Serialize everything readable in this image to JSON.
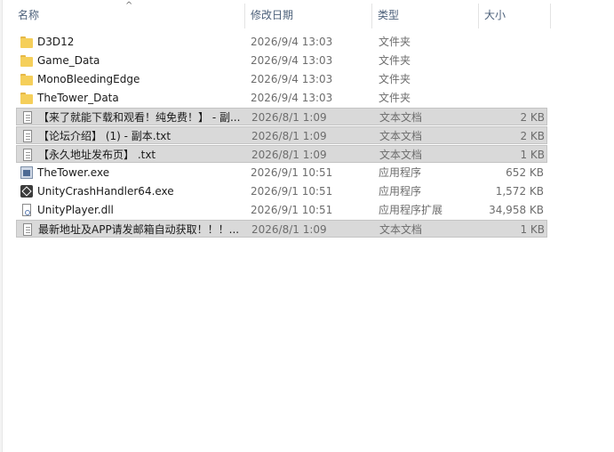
{
  "columns": {
    "name": "名称",
    "date": "修改日期",
    "type": "类型",
    "size": "大小",
    "sort_indicator": "^"
  },
  "files": [
    {
      "name": "D3D12",
      "date": "2026/9/4 13:03",
      "type": "文件夹",
      "size": "",
      "icon": "folder-icon",
      "selected": false
    },
    {
      "name": "Game_Data",
      "date": "2026/9/4 13:03",
      "type": "文件夹",
      "size": "",
      "icon": "folder-icon",
      "selected": false
    },
    {
      "name": "MonoBleedingEdge",
      "date": "2026/9/4 13:03",
      "type": "文件夹",
      "size": "",
      "icon": "folder-icon",
      "selected": false
    },
    {
      "name": "TheTower_Data",
      "date": "2026/9/4 13:03",
      "type": "文件夹",
      "size": "",
      "icon": "folder-icon",
      "selected": false
    },
    {
      "name": "【来了就能下载和观看！纯免费！】 - 副...",
      "date": "2026/8/1 1:09",
      "type": "文本文档",
      "size": "2 KB",
      "icon": "text-document-icon",
      "selected": true
    },
    {
      "name": "【论坛介绍】 (1) - 副本.txt",
      "date": "2026/8/1 1:09",
      "type": "文本文档",
      "size": "2 KB",
      "icon": "text-document-icon",
      "selected": true
    },
    {
      "name": "【永久地址发布页】 .txt",
      "date": "2026/8/1 1:09",
      "type": "文本文档",
      "size": "1 KB",
      "icon": "text-document-icon",
      "selected": true
    },
    {
      "name": "TheTower.exe",
      "date": "2026/9/1 10:51",
      "type": "应用程序",
      "size": "652 KB",
      "icon": "application-icon",
      "selected": false
    },
    {
      "name": "UnityCrashHandler64.exe",
      "date": "2026/9/1 10:51",
      "type": "应用程序",
      "size": "1,572 KB",
      "icon": "unity-icon",
      "selected": false
    },
    {
      "name": "UnityPlayer.dll",
      "date": "2026/9/1 10:51",
      "type": "应用程序扩展",
      "size": "34,958 KB",
      "icon": "dll-icon",
      "selected": false
    },
    {
      "name": "最新地址及APP请发邮箱自动获取！！！...",
      "date": "2026/8/1 1:09",
      "type": "文本文档",
      "size": "1 KB",
      "icon": "text-document-icon",
      "selected": true
    }
  ]
}
